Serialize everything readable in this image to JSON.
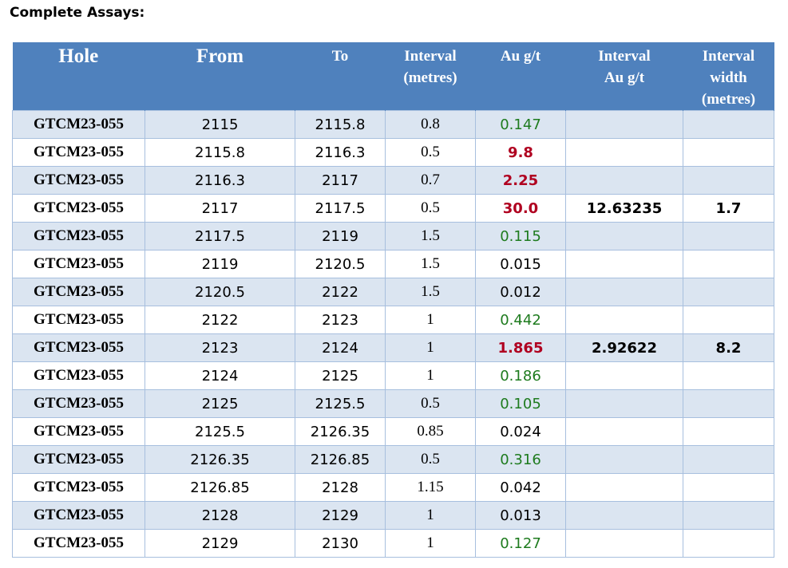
{
  "title": "Complete Assays:",
  "colors": {
    "header_bg": "#4f81bd",
    "row_shade": "#dbe5f1",
    "green": "#1e7b1e",
    "red": "#b00020"
  },
  "headers": {
    "hole": "Hole",
    "from": "From",
    "to": "To",
    "interval_l1": "Interval",
    "interval_l2": "(metres)",
    "au": "Au g/t",
    "interval_au_l1": "Interval",
    "interval_au_l2": "Au g/t",
    "width_l1": "Interval",
    "width_l2": "width",
    "width_l3": "(metres)"
  },
  "rows": [
    {
      "hole": "GTCM23-055",
      "from": "2115",
      "to": "2115.8",
      "interval": "0.8",
      "au": "0.147",
      "au_color": "green",
      "int_au": "",
      "int_width": ""
    },
    {
      "hole": "GTCM23-055",
      "from": "2115.8",
      "to": "2116.3",
      "interval": "0.5",
      "au": "9.8",
      "au_color": "red",
      "int_au": "",
      "int_width": ""
    },
    {
      "hole": "GTCM23-055",
      "from": "2116.3",
      "to": "2117",
      "interval": "0.7",
      "au": "2.25",
      "au_color": "red",
      "int_au": "",
      "int_width": ""
    },
    {
      "hole": "GTCM23-055",
      "from": "2117",
      "to": "2117.5",
      "interval": "0.5",
      "au": "30.0",
      "au_color": "red",
      "int_au": "12.63235",
      "int_width": "1.7"
    },
    {
      "hole": "GTCM23-055",
      "from": "2117.5",
      "to": "2119",
      "interval": "1.5",
      "au": "0.115",
      "au_color": "green",
      "int_au": "",
      "int_width": ""
    },
    {
      "hole": "GTCM23-055",
      "from": "2119",
      "to": "2120.5",
      "interval": "1.5",
      "au": "0.015",
      "au_color": "black",
      "int_au": "",
      "int_width": ""
    },
    {
      "hole": "GTCM23-055",
      "from": "2120.5",
      "to": "2122",
      "interval": "1.5",
      "au": "0.012",
      "au_color": "black",
      "int_au": "",
      "int_width": ""
    },
    {
      "hole": "GTCM23-055",
      "from": "2122",
      "to": "2123",
      "interval": "1",
      "au": "0.442",
      "au_color": "green",
      "int_au": "",
      "int_width": ""
    },
    {
      "hole": "GTCM23-055",
      "from": "2123",
      "to": "2124",
      "interval": "1",
      "au": "1.865",
      "au_color": "red",
      "int_au": "2.92622",
      "int_width": "8.2"
    },
    {
      "hole": "GTCM23-055",
      "from": "2124",
      "to": "2125",
      "interval": "1",
      "au": "0.186",
      "au_color": "green",
      "int_au": "",
      "int_width": ""
    },
    {
      "hole": "GTCM23-055",
      "from": "2125",
      "to": "2125.5",
      "interval": "0.5",
      "au": "0.105",
      "au_color": "green",
      "int_au": "",
      "int_width": ""
    },
    {
      "hole": "GTCM23-055",
      "from": "2125.5",
      "to": "2126.35",
      "interval": "0.85",
      "au": "0.024",
      "au_color": "black",
      "int_au": "",
      "int_width": ""
    },
    {
      "hole": "GTCM23-055",
      "from": "2126.35",
      "to": "2126.85",
      "interval": "0.5",
      "au": "0.316",
      "au_color": "green",
      "int_au": "",
      "int_width": ""
    },
    {
      "hole": "GTCM23-055",
      "from": "2126.85",
      "to": "2128",
      "interval": "1.15",
      "au": "0.042",
      "au_color": "black",
      "int_au": "",
      "int_width": ""
    },
    {
      "hole": "GTCM23-055",
      "from": "2128",
      "to": "2129",
      "interval": "1",
      "au": "0.013",
      "au_color": "black",
      "int_au": "",
      "int_width": ""
    },
    {
      "hole": "GTCM23-055",
      "from": "2129",
      "to": "2130",
      "interval": "1",
      "au": "0.127",
      "au_color": "green",
      "int_au": "",
      "int_width": ""
    }
  ]
}
